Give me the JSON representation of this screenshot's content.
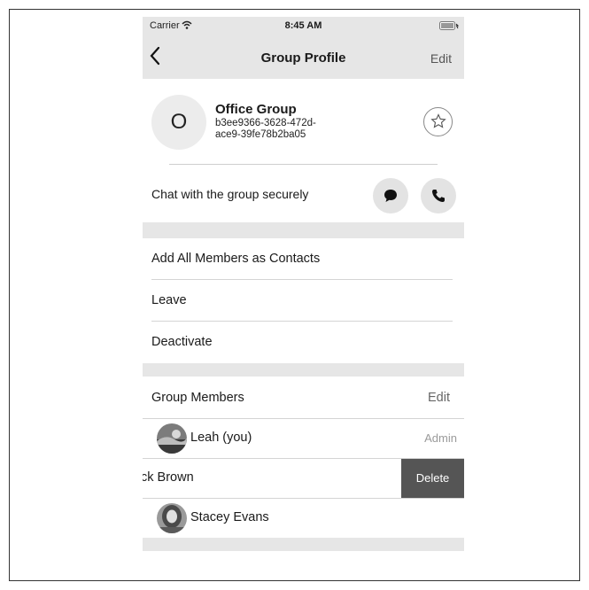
{
  "status_bar": {
    "carrier": "Carrier",
    "time": "8:45 AM"
  },
  "nav": {
    "back_icon": "chevron-left-icon",
    "title": "Group Profile",
    "edit_label": "Edit"
  },
  "profile": {
    "avatar_initial": "O",
    "group_name": "Office Group",
    "group_id": "b3ee9366-3628-472d-ace9-39fe78b2ba05",
    "favorite_icon": "star-icon"
  },
  "chat": {
    "label": "Chat with the group securely",
    "message_icon": "chat-bubble-icon",
    "call_icon": "phone-icon"
  },
  "actions": [
    {
      "label": "Add All Members as Contacts"
    },
    {
      "label": "Leave"
    },
    {
      "label": "Deactivate"
    }
  ],
  "members_section": {
    "title": "Group Members",
    "edit_label": "Edit"
  },
  "members": [
    {
      "name": "Leah (you)",
      "role": "Admin"
    },
    {
      "name": "ıck Brown",
      "action": "Delete"
    },
    {
      "name": "Stacey Evans"
    }
  ],
  "colors": {
    "bar_gray": "#e6e6e6",
    "delete_bg": "#555555"
  }
}
